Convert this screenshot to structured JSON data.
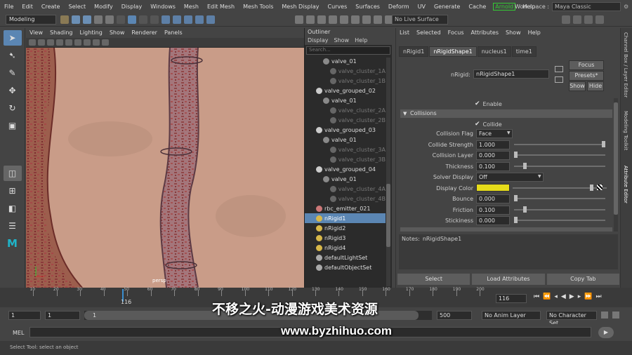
{
  "menubar": {
    "items": [
      "File",
      "Edit",
      "Create",
      "Select",
      "Modify",
      "Display",
      "Windows",
      "Mesh",
      "Edit Mesh",
      "Mesh Tools",
      "Mesh Display",
      "Curves",
      "Surfaces",
      "Deform",
      "UV",
      "Generate",
      "Cache"
    ],
    "arnold": "Arnold",
    "help": "Help",
    "workspace_label": "Workspace :",
    "workspace_value": "Maya Classic"
  },
  "toolbar": {
    "mode": "Modeling",
    "live_surface": "No Live Surface"
  },
  "viewport": {
    "menu": [
      "View",
      "Shading",
      "Lighting",
      "Show",
      "Renderer",
      "Panels"
    ],
    "camera_label": "persp"
  },
  "outliner": {
    "title": "Outliner",
    "menu": [
      "Display",
      "Show",
      "Help"
    ],
    "search_placeholder": "Search...",
    "rows": [
      {
        "label": "valve_01",
        "indent": 2,
        "dim": false,
        "icon": "joint-icon"
      },
      {
        "label": "valve_cluster_1A",
        "indent": 3,
        "dim": true,
        "icon": "cluster-icon"
      },
      {
        "label": "valve_cluster_1B",
        "indent": 3,
        "dim": true,
        "icon": "cluster-icon"
      },
      {
        "label": "valve_grouped_02",
        "indent": 1,
        "dim": false,
        "icon": "group-icon"
      },
      {
        "label": "valve_01",
        "indent": 2,
        "dim": false,
        "icon": "joint-icon"
      },
      {
        "label": "valve_cluster_2A",
        "indent": 3,
        "dim": true,
        "icon": "cluster-icon"
      },
      {
        "label": "valve_cluster_2B",
        "indent": 3,
        "dim": true,
        "icon": "cluster-icon"
      },
      {
        "label": "valve_grouped_03",
        "indent": 1,
        "dim": false,
        "icon": "group-icon"
      },
      {
        "label": "valve_01",
        "indent": 2,
        "dim": false,
        "icon": "joint-icon"
      },
      {
        "label": "valve_cluster_3A",
        "indent": 3,
        "dim": true,
        "icon": "cluster-icon"
      },
      {
        "label": "valve_cluster_3B",
        "indent": 3,
        "dim": true,
        "icon": "cluster-icon"
      },
      {
        "label": "valve_grouped_04",
        "indent": 1,
        "dim": false,
        "icon": "group-icon"
      },
      {
        "label": "valve_01",
        "indent": 2,
        "dim": false,
        "icon": "joint-icon"
      },
      {
        "label": "valve_cluster_4A",
        "indent": 3,
        "dim": true,
        "icon": "cluster-icon"
      },
      {
        "label": "valve_cluster_4B",
        "indent": 3,
        "dim": true,
        "icon": "cluster-icon"
      },
      {
        "label": "rbc_emitter_021",
        "indent": 1,
        "dim": false,
        "icon": "emitter-icon"
      },
      {
        "label": "nRigid1",
        "indent": 1,
        "dim": false,
        "icon": "nrigid-icon",
        "selected": true
      },
      {
        "label": "nRigid2",
        "indent": 1,
        "dim": false,
        "icon": "nrigid-icon"
      },
      {
        "label": "nRigid3",
        "indent": 1,
        "dim": false,
        "icon": "nrigid-icon"
      },
      {
        "label": "nRigid4",
        "indent": 1,
        "dim": false,
        "icon": "nrigid-icon"
      },
      {
        "label": "defaultLightSet",
        "indent": 1,
        "dim": false,
        "icon": "set-icon"
      },
      {
        "label": "defaultObjectSet",
        "indent": 1,
        "dim": false,
        "icon": "set-icon"
      }
    ]
  },
  "attribute_editor": {
    "menu": [
      "List",
      "Selected",
      "Focus",
      "Attributes",
      "Show",
      "Help"
    ],
    "tabs": [
      "nRigid1",
      "nRigidShape1",
      "nucleus1",
      "time1"
    ],
    "active_tab": "nRigidShape1",
    "node_label": "nRigid:",
    "node_value": "nRigidShape1",
    "focus": "Focus",
    "presets": "Presets*",
    "show": "Show",
    "hide": "Hide",
    "enable": "Enable",
    "section": "Collisions",
    "collide": "Collide",
    "fields": [
      {
        "label": "Collision Flag",
        "value": "Face",
        "type": "dropdown"
      },
      {
        "label": "Collide Strength",
        "value": "1.000",
        "type": "slider",
        "level": 1.0
      },
      {
        "label": "Collision Layer",
        "value": "0.000",
        "type": "slider",
        "level": 0.0
      },
      {
        "label": "Thickness",
        "value": "0.100",
        "type": "slider",
        "level": 0.1
      },
      {
        "label": "Solver Display",
        "value": "Off",
        "type": "dropdown"
      },
      {
        "label": "Display Color",
        "value": "",
        "type": "color",
        "color": "#e6dc1a"
      },
      {
        "label": "Bounce",
        "value": "0.000",
        "type": "slider",
        "level": 0.0
      },
      {
        "label": "Friction",
        "value": "0.100",
        "type": "slider",
        "level": 0.1
      },
      {
        "label": "Stickiness",
        "value": "0.000",
        "type": "slider",
        "level": 0.0
      }
    ],
    "notes_label": "Notes:",
    "notes_value": "nRigidShape1",
    "buttons": [
      "Select",
      "Load Attributes",
      "Copy Tab"
    ]
  },
  "right_strip": [
    "Channel Box / Layer Editor",
    "Modeling Toolkit",
    "Attribute Editor"
  ],
  "timeline": {
    "ticks": [
      "10",
      "20",
      "30",
      "40",
      "50",
      "60",
      "70",
      "80",
      "90",
      "100",
      "110",
      "120",
      "130",
      "140",
      "150",
      "160",
      "170",
      "180",
      "190",
      "200"
    ],
    "current_frame": "116",
    "current_frame_field": "116"
  },
  "range": {
    "start": "1",
    "start2": "1",
    "slider_label": "1",
    "end": "500",
    "anim_layer": "No Anim Layer",
    "char_set": "No Character Set"
  },
  "mel": {
    "label": "MEL"
  },
  "help_line": "Select Tool: select an object",
  "watermark": {
    "line1": "不移之火-动漫游戏美术资源",
    "line2": "www.byzhihuo.com"
  }
}
